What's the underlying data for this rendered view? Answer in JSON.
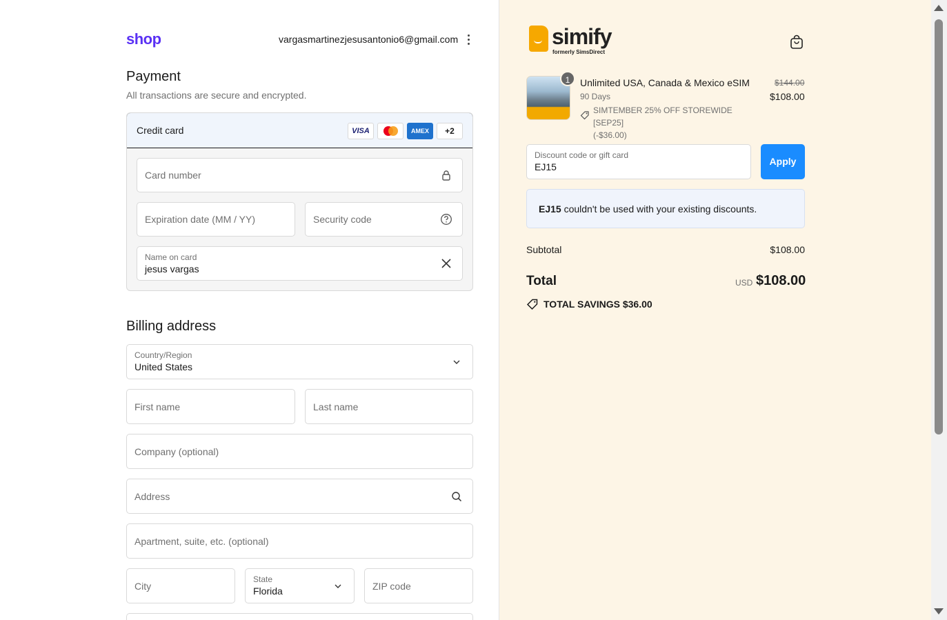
{
  "header": {
    "shop_logo": "shop",
    "email": "vargasmartinezjesusantonio6@gmail.com"
  },
  "payment": {
    "title": "Payment",
    "subtitle": "All transactions are secure and encrypted.",
    "method_label": "Credit card",
    "card_brands": [
      "VISA",
      "mastercard",
      "AMEX",
      "+2"
    ],
    "card_number_placeholder": "Card number",
    "expiration_placeholder": "Expiration date (MM / YY)",
    "security_code_placeholder": "Security code",
    "name_label": "Name on card",
    "name_value": "jesus vargas"
  },
  "billing": {
    "title": "Billing address",
    "country_label": "Country/Region",
    "country_value": "United States",
    "first_name_placeholder": "First name",
    "last_name_placeholder": "Last name",
    "company_placeholder": "Company (optional)",
    "address_placeholder": "Address",
    "apartment_placeholder": "Apartment, suite, etc. (optional)",
    "city_placeholder": "City",
    "state_label": "State",
    "state_value": "Florida",
    "zip_placeholder": "ZIP code"
  },
  "summary": {
    "brand_name": "simify",
    "brand_tagline": "formerly SimsDirect",
    "item": {
      "quantity": "1",
      "name": "Unlimited USA, Canada & Mexico eSIM",
      "variant": "90 Days",
      "discount_line1": "SIMTEMBER 25% OFF STOREWIDE [SEP25]",
      "discount_line2": "(-$36.00)",
      "original_price": "$144.00",
      "price": "$108.00"
    },
    "discount_field_label": "Discount code or gift card",
    "discount_field_value": "EJ15",
    "apply_label": "Apply",
    "notice_code": "EJ15",
    "notice_text": " couldn't be used with your existing discounts.",
    "subtotal_label": "Subtotal",
    "subtotal_value": "$108.00",
    "total_label": "Total",
    "total_currency": "USD",
    "total_value": "$108.00",
    "savings_text": "TOTAL SAVINGS  $36.00"
  },
  "colors": {
    "shop_brand": "#5a31f4",
    "apply_button": "#1a8cff",
    "summary_bg": "#fdf5e6",
    "simify_orange": "#f6a800"
  }
}
